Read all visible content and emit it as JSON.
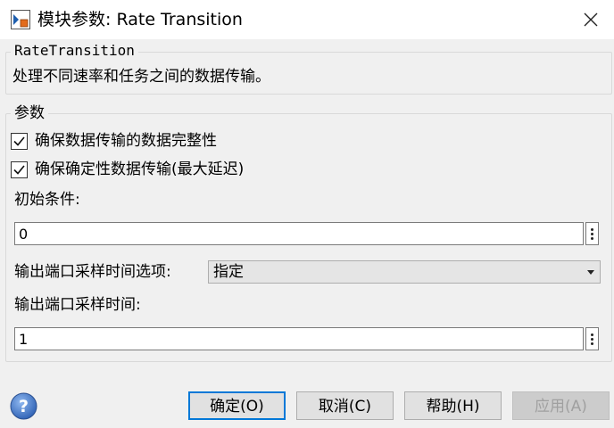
{
  "window": {
    "title": "模块参数: Rate Transition"
  },
  "block_info": {
    "name": "RateTransition",
    "description": "处理不同速率和任务之间的数据传输。"
  },
  "parameters": {
    "legend": "参数",
    "ensure_integrity_label": "确保数据传输的数据完整性",
    "ensure_integrity_checked": true,
    "ensure_deterministic_label": "确保确定性数据传输(最大延迟)",
    "ensure_deterministic_checked": true,
    "initial_condition_label": "初始条件:",
    "initial_condition_value": "0",
    "sample_time_option_label": "输出端口采样时间选项:",
    "sample_time_option_value": "指定",
    "sample_time_label": "输出端口采样时间:",
    "sample_time_value": "1"
  },
  "buttons": {
    "ok": "确定(O)",
    "cancel": "取消(C)",
    "help": "帮助(H)",
    "apply": "应用(A)"
  },
  "icons": {
    "app": "simulink-block-icon",
    "close": "close-icon",
    "help": "question-icon",
    "check": "checkmark-icon",
    "more": "kebab-menu-icon",
    "dropdown": "chevron-down-icon"
  },
  "colors": {
    "accent": "#0078d7",
    "help_icon": "#3b73c8"
  }
}
